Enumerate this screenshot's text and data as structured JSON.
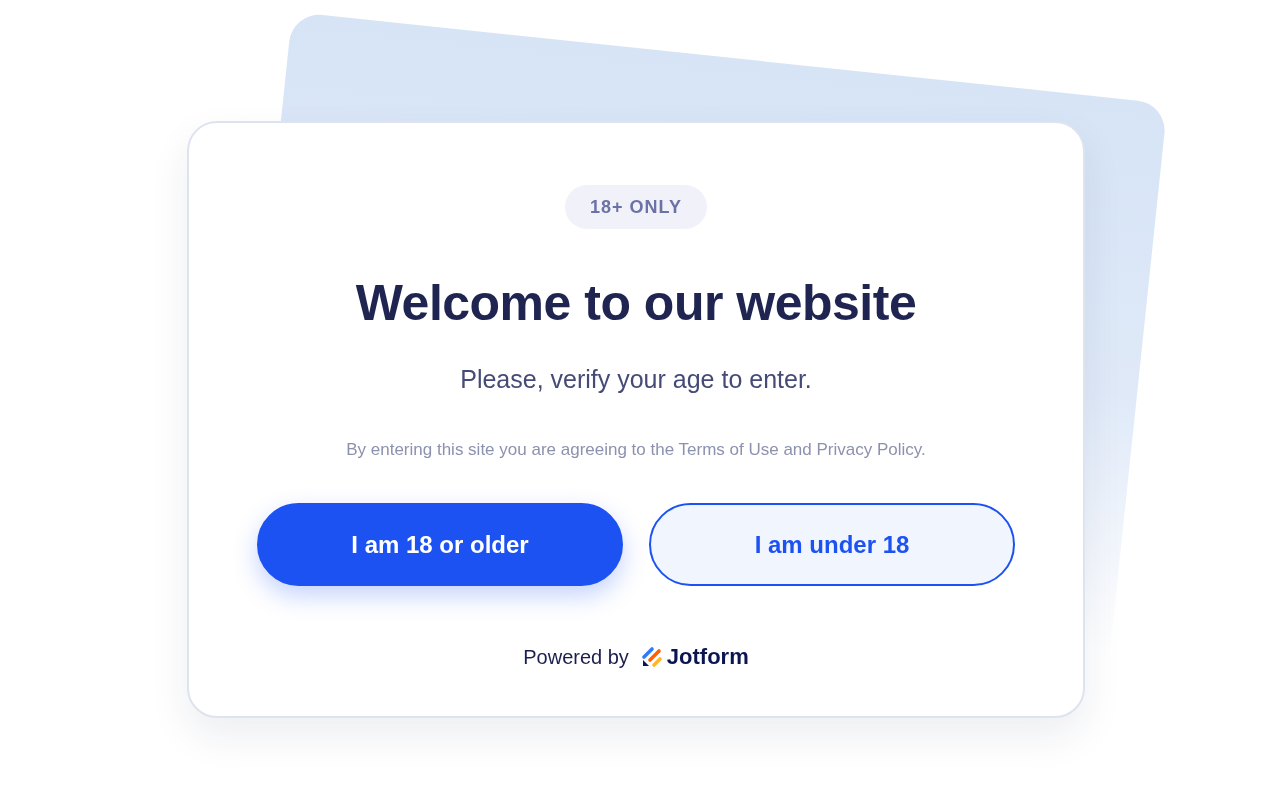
{
  "badge": "18+ ONLY",
  "title": "Welcome to our website",
  "subtitle": "Please, verify your age to enter.",
  "terms": "By entering this site you are agreeing to the Terms of Use and Privacy Policy.",
  "buttons": [
    {
      "label": "I am 18 or older",
      "kind": "primary"
    },
    {
      "label": "I am under 18",
      "kind": "secondary"
    }
  ],
  "footer": {
    "powered_by": "Powered by",
    "brand": "Jotform"
  }
}
